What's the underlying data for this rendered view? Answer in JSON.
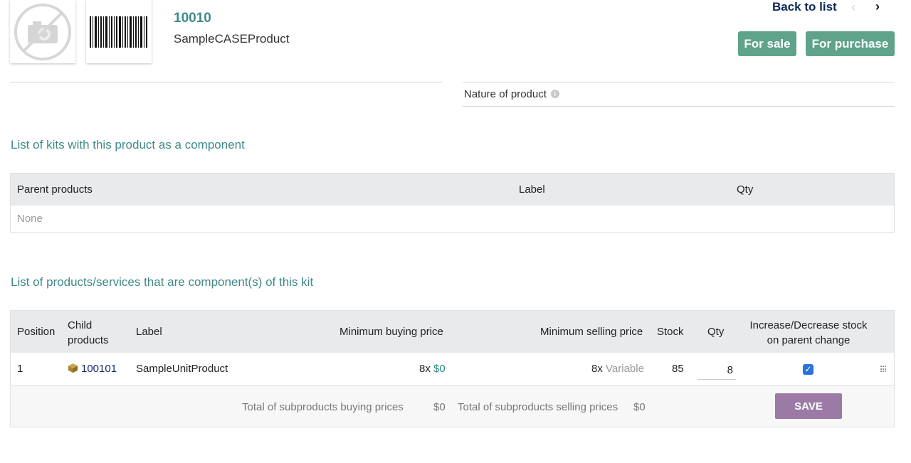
{
  "product": {
    "ref": "10010",
    "label": "SampleCASEProduct"
  },
  "header": {
    "back_to_list": "Back to list",
    "prev_glyph": "‹",
    "next_glyph": "›",
    "for_sale": "For sale",
    "for_purchase": "For purchase",
    "status_color": "#5ea38a"
  },
  "fields": {
    "nature_label": "Nature of product",
    "info_glyph": "i"
  },
  "kits_parent": {
    "title": "List of kits with this product as a component",
    "columns": [
      "Parent products",
      "Label",
      "Qty"
    ],
    "empty": "None"
  },
  "kits_children": {
    "title": "List of products/services that are component(s) of this kit",
    "columns": {
      "position": "Position",
      "child_line1": "Child",
      "child_line2": "products",
      "label": "Label",
      "min_buy": "Minimum buying price",
      "min_sell": "Minimum selling price",
      "stock": "Stock",
      "qty": "Qty",
      "incdec_line1": "Increase/Decrease stock",
      "incdec_line2": "on parent change"
    },
    "rows": [
      {
        "position": "1",
        "ref": "100101",
        "label": "SampleUnitProduct",
        "buy_mult": "8x",
        "buy_price": "$0",
        "sell_mult": "8x",
        "sell_price": "Variable",
        "stock": "85",
        "qty": "8",
        "check": "✓"
      }
    ],
    "footer": {
      "total_buy_label": "Total of subproducts buying prices",
      "total_buy": "$0",
      "total_sell_label": "Total of subproducts selling prices",
      "total_sell": "$0",
      "save": "SAVE"
    }
  },
  "colors": {
    "accent_teal": "#3e8a89",
    "save_button": "#9b7ba6",
    "link_navy": "#12286b"
  }
}
